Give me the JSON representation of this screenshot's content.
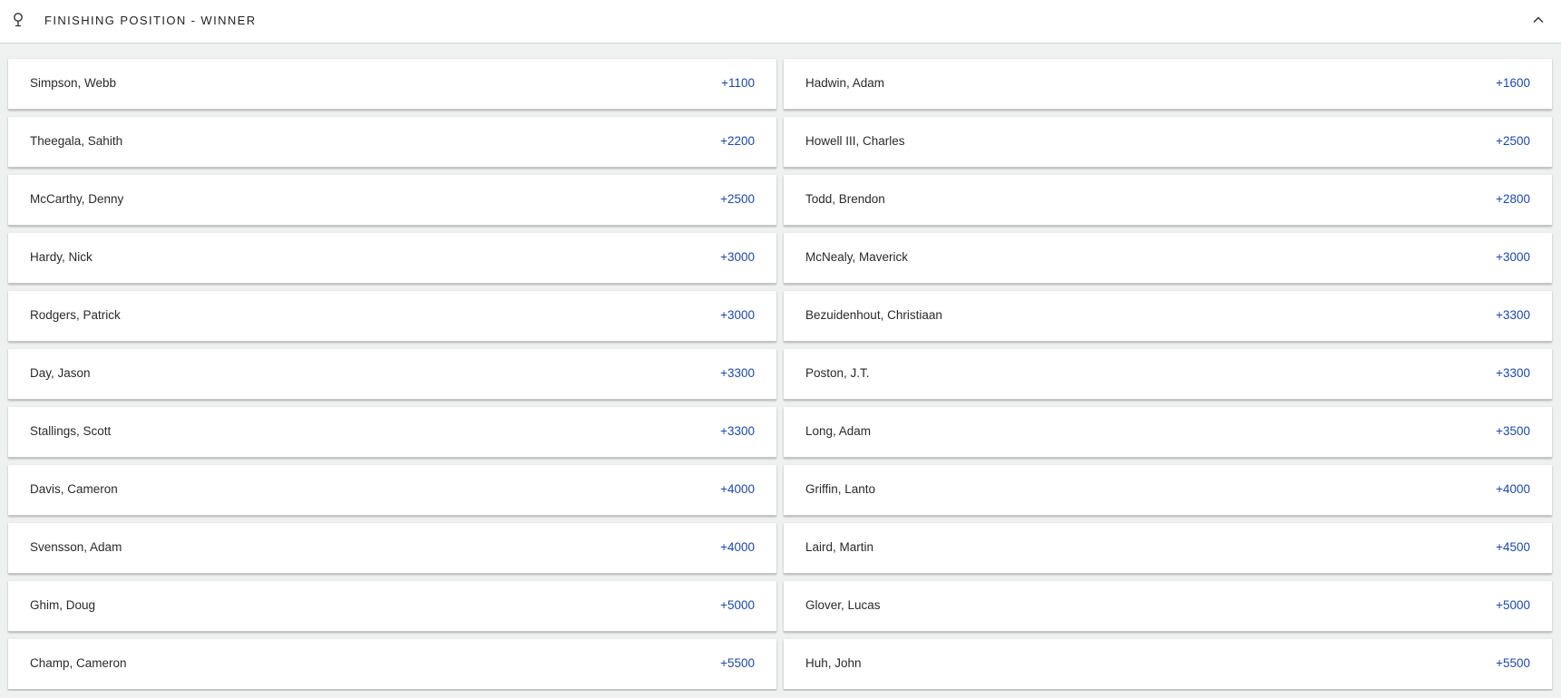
{
  "header": {
    "title": "FINISHING POSITION - WINNER",
    "left_icon": "map-pin-icon",
    "right_icon": "chevron-up-icon"
  },
  "colors": {
    "odds": "#1d48a8",
    "background": "#eff0f0",
    "card": "#ffffff"
  },
  "rows": [
    {
      "left": {
        "name": "Simpson, Webb",
        "odds": "+1100"
      },
      "right": {
        "name": "Hadwin, Adam",
        "odds": "+1600"
      }
    },
    {
      "left": {
        "name": "Theegala, Sahith",
        "odds": "+2200"
      },
      "right": {
        "name": "Howell III, Charles",
        "odds": "+2500"
      }
    },
    {
      "left": {
        "name": "McCarthy, Denny",
        "odds": "+2500"
      },
      "right": {
        "name": "Todd, Brendon",
        "odds": "+2800"
      }
    },
    {
      "left": {
        "name": "Hardy, Nick",
        "odds": "+3000"
      },
      "right": {
        "name": "McNealy, Maverick",
        "odds": "+3000"
      }
    },
    {
      "left": {
        "name": "Rodgers, Patrick",
        "odds": "+3000"
      },
      "right": {
        "name": "Bezuidenhout, Christiaan",
        "odds": "+3300"
      }
    },
    {
      "left": {
        "name": "Day, Jason",
        "odds": "+3300"
      },
      "right": {
        "name": "Poston, J.T.",
        "odds": "+3300"
      }
    },
    {
      "left": {
        "name": "Stallings, Scott",
        "odds": "+3300"
      },
      "right": {
        "name": "Long, Adam",
        "odds": "+3500"
      }
    },
    {
      "left": {
        "name": "Davis, Cameron",
        "odds": "+4000"
      },
      "right": {
        "name": "Griffin, Lanto",
        "odds": "+4000"
      }
    },
    {
      "left": {
        "name": "Svensson, Adam",
        "odds": "+4000"
      },
      "right": {
        "name": "Laird, Martin",
        "odds": "+4500"
      }
    },
    {
      "left": {
        "name": "Ghim, Doug",
        "odds": "+5000"
      },
      "right": {
        "name": "Glover, Lucas",
        "odds": "+5000"
      }
    },
    {
      "left": {
        "name": "Champ, Cameron",
        "odds": "+5500"
      },
      "right": {
        "name": "Huh, John",
        "odds": "+5500"
      }
    }
  ]
}
